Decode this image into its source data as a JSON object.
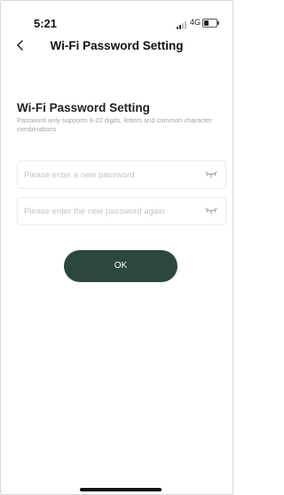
{
  "status_bar": {
    "time": "5:21",
    "network": "4G",
    "signal_icon": "signal-bars-icon",
    "battery_icon": "battery-icon",
    "battery_level": 0.35
  },
  "nav": {
    "back_icon": "chevron-left-icon",
    "title": "Wi-Fi Password Setting"
  },
  "form": {
    "title": "Wi-Fi Password Setting",
    "hint": "Password only supports 8-22 digits, letters and common character combinations",
    "new_password": {
      "value": "",
      "placeholder": "Please enter a new password",
      "icon": "eye-closed-icon"
    },
    "confirm_password": {
      "value": "",
      "placeholder": "Please enter the new password again",
      "icon": "eye-closed-icon"
    },
    "ok_label": "OK"
  },
  "colors": {
    "accent": "#2c4640",
    "placeholder": "#c4c4c4",
    "hint": "#a4a4a4"
  }
}
